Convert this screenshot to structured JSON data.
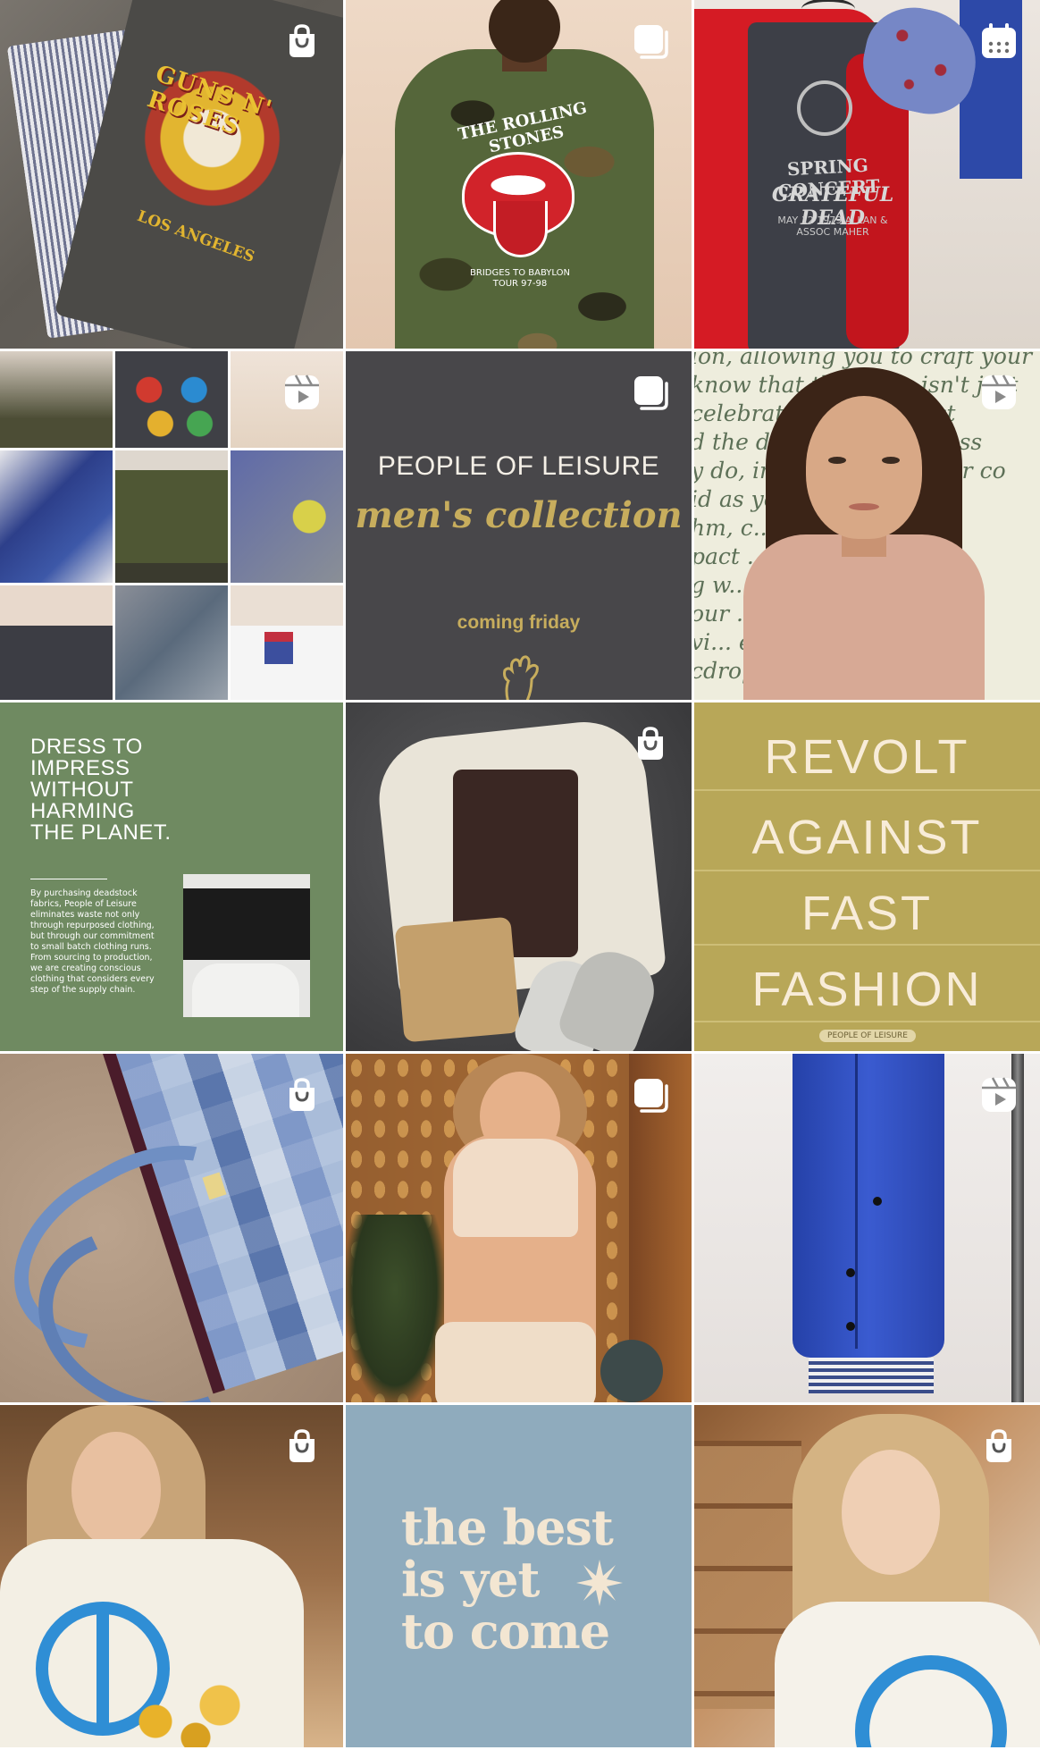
{
  "grid": {
    "posts": [
      {
        "id": "post-1",
        "badge": "shopping-bag-icon"
      },
      {
        "id": "post-2",
        "badge": "carousel-icon"
      },
      {
        "id": "post-3",
        "badge": "calendar-icon"
      },
      {
        "id": "post-4",
        "badge": "reel-icon"
      },
      {
        "id": "post-5",
        "badge": "carousel-icon"
      },
      {
        "id": "post-6",
        "badge": "reel-icon"
      },
      {
        "id": "post-7",
        "badge": ""
      },
      {
        "id": "post-8",
        "badge": "shopping-bag-icon"
      },
      {
        "id": "post-9",
        "badge": ""
      },
      {
        "id": "post-10",
        "badge": "shopping-bag-icon"
      },
      {
        "id": "post-11",
        "badge": "carousel-icon"
      },
      {
        "id": "post-12",
        "badge": "reel-icon"
      },
      {
        "id": "post-13",
        "badge": "shopping-bag-icon"
      },
      {
        "id": "post-14",
        "badge": ""
      },
      {
        "id": "post-15",
        "badge": "shopping-bag-icon"
      }
    ]
  },
  "post1": {
    "print_title": "GUNS N' ROSES",
    "print_city": "LOS ANGELES"
  },
  "post2": {
    "print_title": "THE ROLLING STONES",
    "print_sub": "BRIDGES TO BABYLON TOUR 97-98"
  },
  "post3": {
    "line1": "SPRING CONCERT",
    "line2": "GRATEFUL DEAD",
    "line3": "MAY 12 1979 ALLAN & ASSOC MAHER"
  },
  "post5": {
    "brand": "PEOPLE OF LEISURE",
    "collection": "men's collection",
    "cta": "coming friday"
  },
  "post6": {
    "script_lines": [
      "ion, allowing you to craft your own",
      "know that the jeans isn't just",
      "celebrating the distinct",
      "d the doers, the effortless",
      "y do, including ours. Our co",
      "id as you find of jeans.",
      "hm, c... from recl",
      "pact ... fibres a",
      "g w... on, is",
      "our ... the",
      "vi... eme",
      "cdrop ... ur de"
    ]
  },
  "post7": {
    "headline": "DRESS TO\nIMPRESS\nWITHOUT\nHARMING\nTHE PLANET.",
    "body": "By purchasing deadstock fabrics, People of Leisure eliminates waste not only through repurposed clothing, but through our commitment to small batch clothing runs. From sourcing to production, we are creating conscious clothing that considers every step of the supply chain."
  },
  "post9": {
    "words": [
      "REVOLT",
      "AGAINST",
      "FAST",
      "FASHION"
    ],
    "tag": "PEOPLE OF LEISURE"
  },
  "post14": {
    "line1": "the best",
    "line2": "is yet",
    "line3": "to come"
  },
  "colors": {
    "revolt_bg": "#b8a758",
    "green_bg": "#6f8a61",
    "dark_bg": "#48474a",
    "blue_bg": "#8fabbd",
    "gold": "#c7ad5d"
  }
}
